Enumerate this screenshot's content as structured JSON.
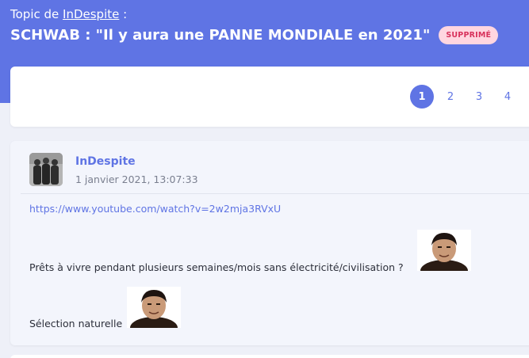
{
  "header": {
    "topic_prefix": "Topic de",
    "topic_author": "InDespite",
    "topic_suffix": ":",
    "title": "SCHWAB : \"Il y aura une PANNE MONDIALE en 2021\"",
    "status_badge": "SUPPRIMÉ"
  },
  "pagination": {
    "pages": [
      "1",
      "2",
      "3",
      "4"
    ],
    "current": "1"
  },
  "post": {
    "author": "InDespite",
    "date": "1 janvier 2021, 13:07:33",
    "link": "https://www.youtube.com/watch?v=2w2mja3RVxU",
    "line1": "Prêts à vivre pendant plusieurs semaines/mois sans électricité/civilisation ?",
    "line2": "Sélection naturelle"
  },
  "colors": {
    "accent": "#5f74e4",
    "badge_bg": "#ffd6e0",
    "badge_text": "#d8315b"
  }
}
